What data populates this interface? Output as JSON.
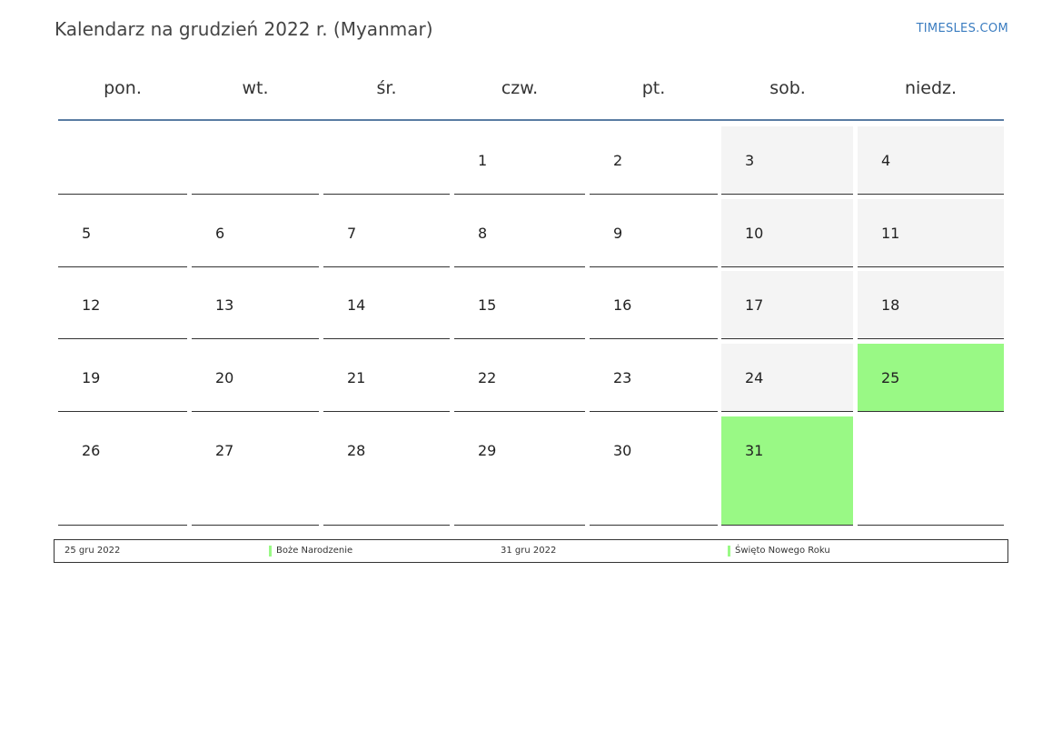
{
  "header": {
    "title": "Kalendarz na grudzień 2022 r. (Myanmar)",
    "brand": "TIMESLES.COM"
  },
  "weekdays": [
    "pon.",
    "wt.",
    "śr.",
    "czw.",
    "pt.",
    "sob.",
    "niedz."
  ],
  "colors": {
    "holiday": "#99f985",
    "weekend": "#f4f4f4",
    "header_line": "#5a7ca3",
    "brand": "#3a7cc0"
  },
  "weeks": [
    [
      "",
      "",
      "",
      "1",
      "2",
      "3",
      "4"
    ],
    [
      "5",
      "6",
      "7",
      "8",
      "9",
      "10",
      "11"
    ],
    [
      "12",
      "13",
      "14",
      "15",
      "16",
      "17",
      "18"
    ],
    [
      "19",
      "20",
      "21",
      "22",
      "23",
      "24",
      "25"
    ],
    [
      "26",
      "27",
      "28",
      "29",
      "30",
      "31",
      ""
    ]
  ],
  "holidays": [
    "25",
    "31"
  ],
  "legend": [
    {
      "date": "25 gru 2022",
      "name": "Boże Narodzenie"
    },
    {
      "date": "31 gru 2022",
      "name": "Święto Nowego Roku"
    }
  ]
}
